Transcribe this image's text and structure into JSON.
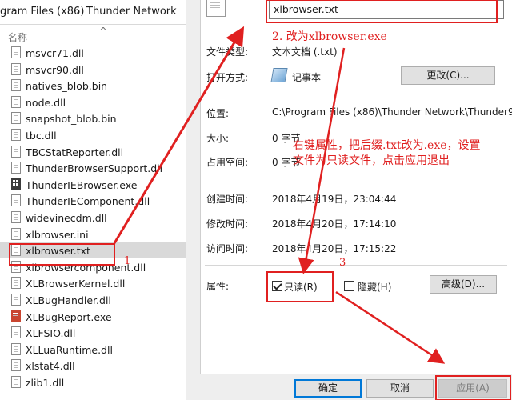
{
  "explorer": {
    "breadcrumb": [
      "gram Files (x86)",
      "Thunder Network"
    ],
    "breadcrumb_separator": "›",
    "column_header": "名称",
    "sort_caret": "^",
    "files": [
      {
        "name": "msvcr71.dll",
        "icon": "dll-file-icon"
      },
      {
        "name": "msvcr90.dll",
        "icon": "dll-file-icon"
      },
      {
        "name": "natives_blob.bin",
        "icon": "file-icon"
      },
      {
        "name": "node.dll",
        "icon": "dll-file-icon"
      },
      {
        "name": "snapshot_blob.bin",
        "icon": "file-icon"
      },
      {
        "name": "tbc.dll",
        "icon": "dll-file-icon"
      },
      {
        "name": "TBCStatReporter.dll",
        "icon": "dll-file-icon"
      },
      {
        "name": "ThunderBrowserSupport.dll",
        "icon": "dll-file-icon"
      },
      {
        "name": "ThunderIEBrowser.exe",
        "icon": "exe-icon"
      },
      {
        "name": "ThunderIEComponent.dll",
        "icon": "dll-file-icon"
      },
      {
        "name": "widevinecdm.dll",
        "icon": "dll-file-icon"
      },
      {
        "name": "xlbrowser.ini",
        "icon": "ini-file-icon"
      },
      {
        "name": "xlbrowser.txt",
        "icon": "text-file-icon",
        "selected": true
      },
      {
        "name": "xlbrowsercomponent.dll",
        "icon": "dll-file-icon"
      },
      {
        "name": "XLBrowserKernel.dll",
        "icon": "dll-file-icon"
      },
      {
        "name": "XLBugHandler.dll",
        "icon": "dll-file-icon"
      },
      {
        "name": "XLBugReport.exe",
        "icon": "bug-report-icon"
      },
      {
        "name": "XLFSIO.dll",
        "icon": "dll-file-icon"
      },
      {
        "name": "XLLuaRuntime.dll",
        "icon": "dll-file-icon"
      },
      {
        "name": "xlstat4.dll",
        "icon": "dll-file-icon"
      },
      {
        "name": "zlib1.dll",
        "icon": "dll-file-icon"
      }
    ]
  },
  "properties": {
    "filename": "xlbrowser.txt",
    "file_type_label": "文件类型:",
    "file_type_value": "文本文档 (.txt)",
    "open_with_label": "打开方式:",
    "open_with_value": "记事本",
    "change_button": "更改(C)...",
    "location_label": "位置:",
    "location_value": "C:\\Program Files (x86)\\Thunder Network\\Thunder9",
    "size_label": "大小:",
    "size_value": "0 字节",
    "size_on_disk_label": "占用空间:",
    "size_on_disk_value": "0 字节",
    "created_label": "创建时间:",
    "created_value": "2018年4月19日，23:04:44",
    "modified_label": "修改时间:",
    "modified_value": "2018年4月20日，17:14:10",
    "accessed_label": "访问时间:",
    "accessed_value": "2018年4月20日，17:15:22",
    "attributes_label": "属性:",
    "readonly_label": "只读(R)",
    "readonly_checked": true,
    "hidden_label": "隐藏(H)",
    "hidden_checked": false,
    "advanced_button": "高级(D)...",
    "ok_button": "确定",
    "cancel_button": "取消",
    "apply_button": "应用(A)"
  },
  "annotations": {
    "step1": "1",
    "step2": "2. 改为xlbrowser.exe",
    "step3": "3",
    "instruction_line1": "右键属性，把后缀.txt改为.exe，设置",
    "instruction_line2": "文件为只读文件，点击应用退出",
    "color": "#e02020"
  }
}
